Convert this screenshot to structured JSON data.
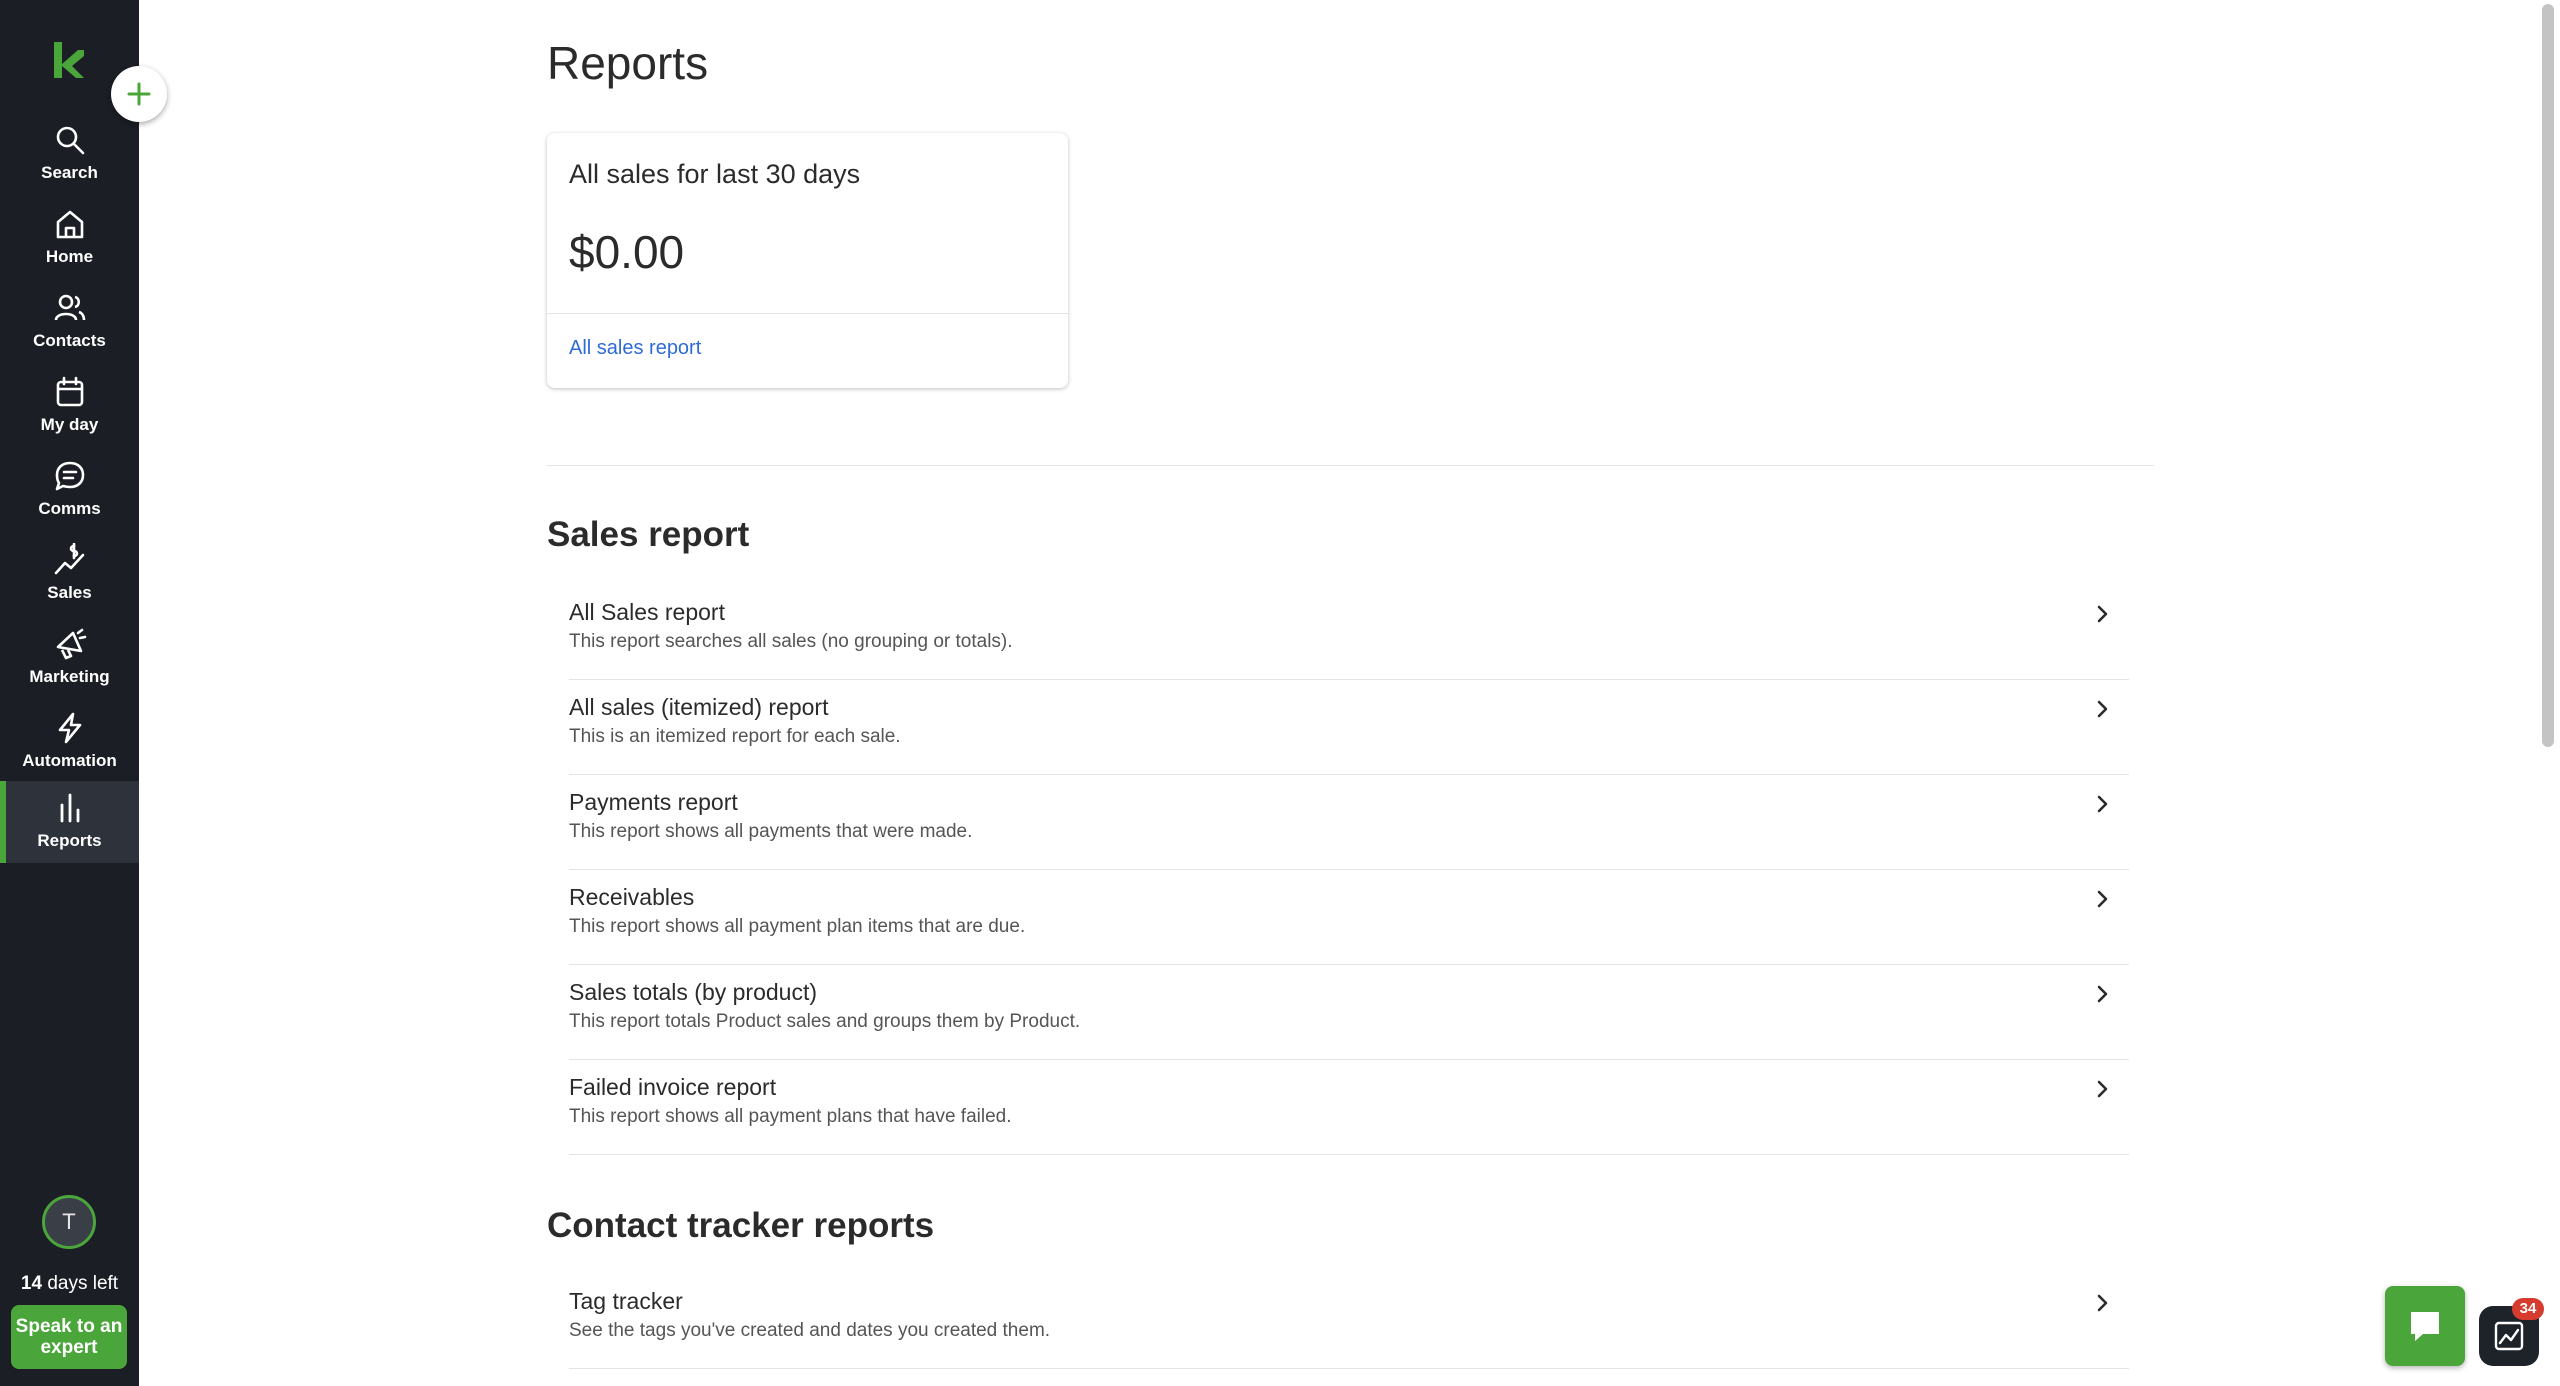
{
  "sidebar": {
    "items": [
      {
        "label": "Search",
        "icon": "search-icon"
      },
      {
        "label": "Home",
        "icon": "home-icon"
      },
      {
        "label": "Contacts",
        "icon": "contacts-icon"
      },
      {
        "label": "My day",
        "icon": "calendar-icon"
      },
      {
        "label": "Comms",
        "icon": "chat-bubble-icon"
      },
      {
        "label": "Sales",
        "icon": "sales-icon"
      },
      {
        "label": "Marketing",
        "icon": "megaphone-icon"
      },
      {
        "label": "Automation",
        "icon": "lightning-icon"
      },
      {
        "label": "Reports",
        "icon": "bar-chart-icon",
        "active": true
      }
    ],
    "avatar_initial": "T",
    "trial_days": "14",
    "trial_suffix": " days left",
    "expert_label": "Speak to an expert"
  },
  "page": {
    "title": "Reports"
  },
  "summary_card": {
    "title": "All sales for last 30 days",
    "amount": "$0.00",
    "link": "All sales report"
  },
  "sections": [
    {
      "title": "Sales report",
      "reports": [
        {
          "name": "All Sales report",
          "description": "This report searches all sales (no grouping or totals)."
        },
        {
          "name": "All sales (itemized) report",
          "description": "This is an itemized report for each sale."
        },
        {
          "name": "Payments report",
          "description": "This report shows all payments that were made."
        },
        {
          "name": "Receivables",
          "description": "This report shows all payment plan items that are due."
        },
        {
          "name": "Sales totals (by product)",
          "description": "This report totals Product sales and groups them by Product."
        },
        {
          "name": "Failed invoice report",
          "description": "This report shows all payment plans that have failed."
        }
      ]
    },
    {
      "title": "Contact tracker reports",
      "reports": [
        {
          "name": "Tag tracker",
          "description": "See the tags you've created and dates you created them."
        }
      ]
    }
  ],
  "widgets": {
    "notification_count": "34"
  },
  "colors": {
    "brand_green": "#4aa63a",
    "sidebar_bg": "#1b1e24",
    "link_blue": "#2f6bd8",
    "badge_red": "#d63b2f"
  }
}
